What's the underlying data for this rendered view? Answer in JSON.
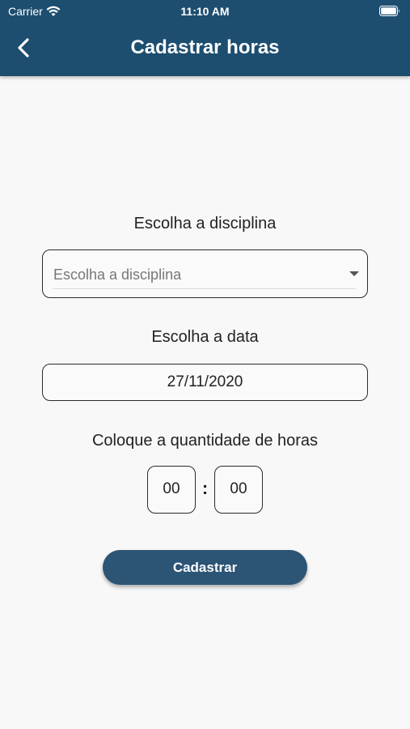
{
  "status_bar": {
    "carrier": "Carrier",
    "time": "11:10 AM"
  },
  "header": {
    "title": "Cadastrar horas",
    "background": "#1d4e70"
  },
  "form": {
    "discipline_label": "Escolha a disciplina",
    "discipline_placeholder": "Escolha a disciplina",
    "date_label": "Escolha a data",
    "date_value": "27/11/2020",
    "hours_label": "Coloque a quantidade de horas",
    "hours_value": "00",
    "minutes_value": "00",
    "separator": ":",
    "submit_label": "Cadastrar",
    "button_color": "#2c5475"
  },
  "icons": [
    "wifi-icon",
    "battery-icon",
    "back-arrow-icon",
    "dropdown-caret-icon"
  ]
}
